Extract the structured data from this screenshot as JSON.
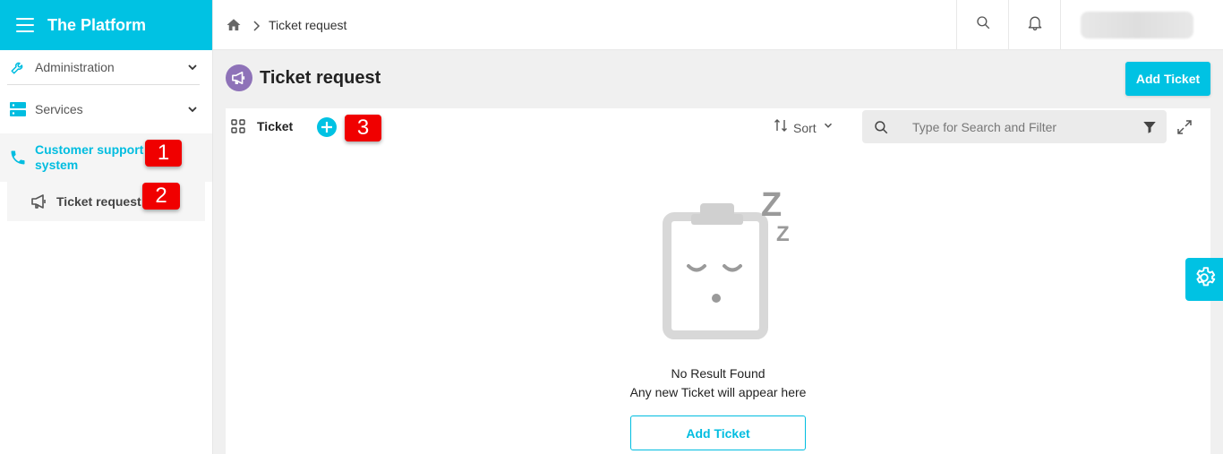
{
  "app": {
    "title": "The Platform"
  },
  "sidebar": {
    "items": [
      {
        "label": "Administration",
        "icon": "wrench-icon"
      },
      {
        "label": "Services",
        "icon": "server-icon"
      },
      {
        "label": "Customer support system",
        "icon": "phone-icon",
        "active": true
      },
      {
        "label": "Ticket request",
        "icon": "megaphone-icon",
        "sub": true
      }
    ]
  },
  "breadcrumb": {
    "current": "Ticket request"
  },
  "page": {
    "title": "Ticket request",
    "add_button": "Add Ticket"
  },
  "toolbar": {
    "title": "Ticket",
    "sort_label": "Sort",
    "search_placeholder": "Type for Search and Filter"
  },
  "empty": {
    "line1": "No Result Found",
    "line2": "Any new Ticket will appear here",
    "button": "Add Ticket"
  },
  "annotations": [
    "1",
    "2",
    "3"
  ],
  "colors": {
    "accent": "#00c2e3",
    "page_icon_bg": "#8e72b8",
    "annotation": "#f00000"
  }
}
